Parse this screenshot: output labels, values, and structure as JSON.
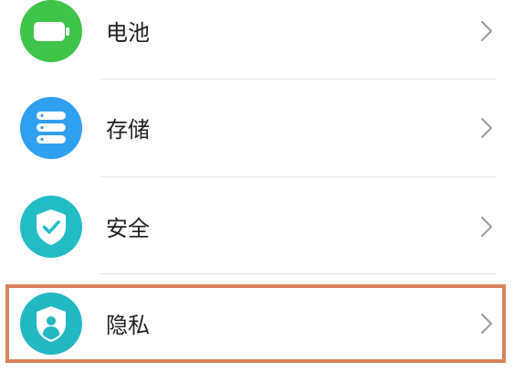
{
  "colors": {
    "battery_icon_bg": "#3fc44a",
    "storage_icon_bg": "#2f9ff0",
    "security_icon_bg": "#22bcc4",
    "privacy_icon_bg": "#22b8c2",
    "highlight_border": "#d9835a",
    "chevron": "#9a9a9a",
    "divider": "#e3e3e3"
  },
  "settings": {
    "items": [
      {
        "label": "电池",
        "icon": "battery-icon"
      },
      {
        "label": "存储",
        "icon": "storage-icon"
      },
      {
        "label": "安全",
        "icon": "shield-check-icon"
      },
      {
        "label": "隐私",
        "icon": "privacy-shield-icon"
      }
    ]
  }
}
